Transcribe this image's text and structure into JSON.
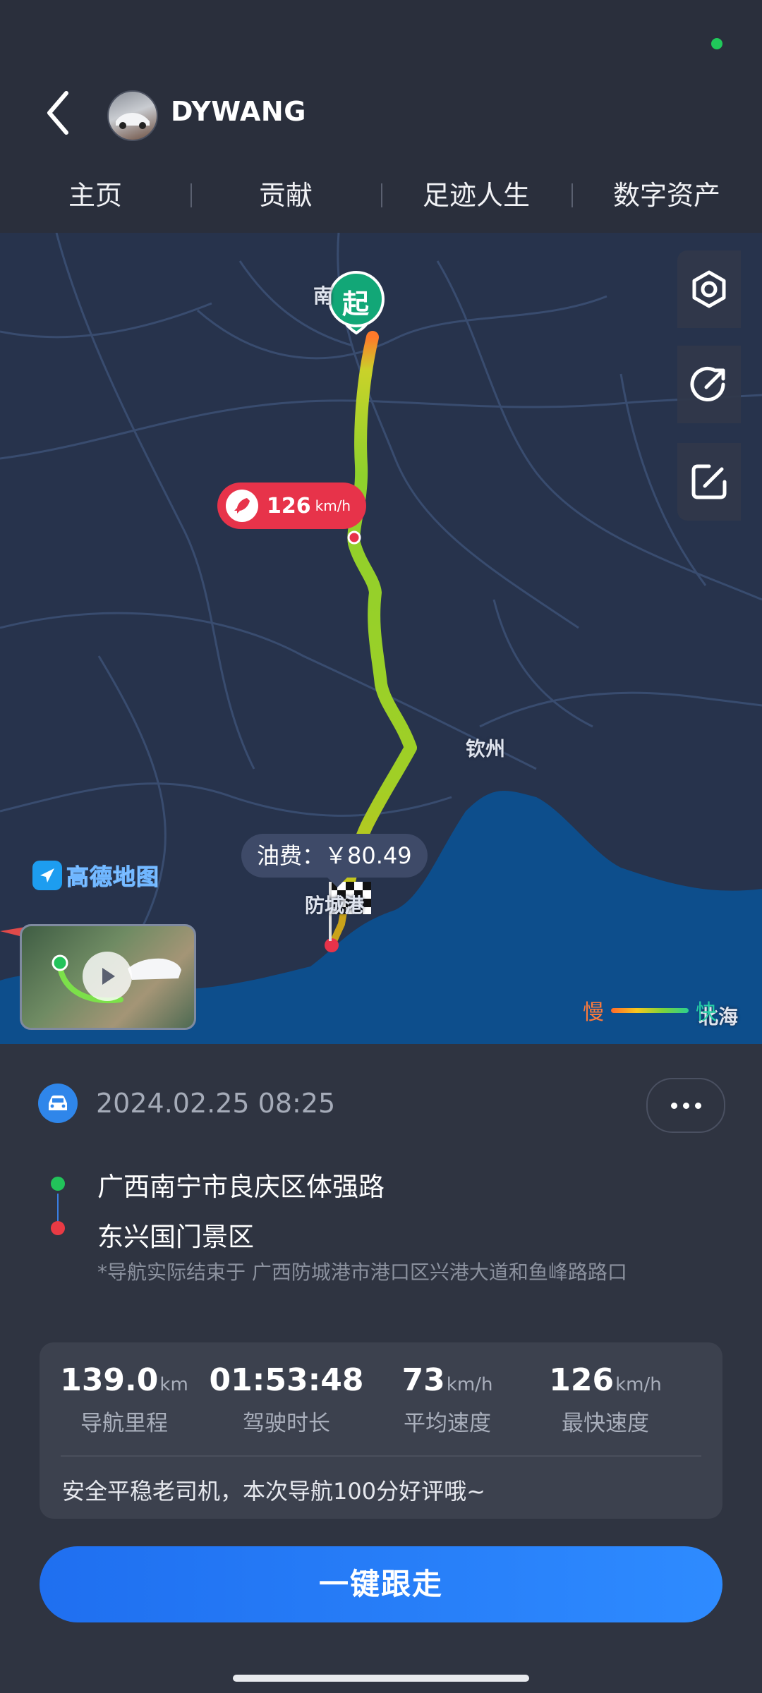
{
  "header": {
    "username": "DYWANG",
    "tabs": [
      "主页",
      "贡献",
      "足迹人生",
      "数字资产"
    ]
  },
  "map": {
    "start_marker": "起",
    "city_nanning": "南",
    "city_qinzhou": "钦州",
    "city_fangchenggang": "防城港",
    "city_beihai": "北海",
    "max_speed_value": "126",
    "max_speed_unit": "km/h",
    "fuel_cost": "油费：￥80.49",
    "provider_logo": "高德地图",
    "legend_slow": "慢",
    "legend_fast": "快",
    "icons": [
      "settings-icon",
      "share-icon",
      "edit-icon",
      "rocket-icon",
      "play-icon",
      "finish-flag-icon"
    ],
    "colors": {
      "route_start": "#ff7a2a",
      "route_mid": "#8ccf2a",
      "sea": "#0d4e8c",
      "speed_badge": "#e7334a"
    }
  },
  "trip": {
    "datetime": "2024.02.25 08:25",
    "start_address": "广西南宁市良庆区体强路",
    "end_address": "东兴国门景区",
    "note": "*导航实际结束于 广西防城港市港口区兴港大道和鱼峰路路口"
  },
  "stats": {
    "distance_value": "139.0",
    "distance_unit": "km",
    "distance_label": "导航里程",
    "duration_value": "01:53:48",
    "duration_label": "驾驶时长",
    "avg_speed_value": "73",
    "avg_speed_unit": "km/h",
    "avg_speed_label": "平均速度",
    "max_speed_value": "126",
    "max_speed_unit": "km/h",
    "max_speed_label": "最快速度",
    "comment": "安全平稳老司机，本次导航100分好评哦~"
  },
  "actions": {
    "follow_label": "一键跟走"
  }
}
